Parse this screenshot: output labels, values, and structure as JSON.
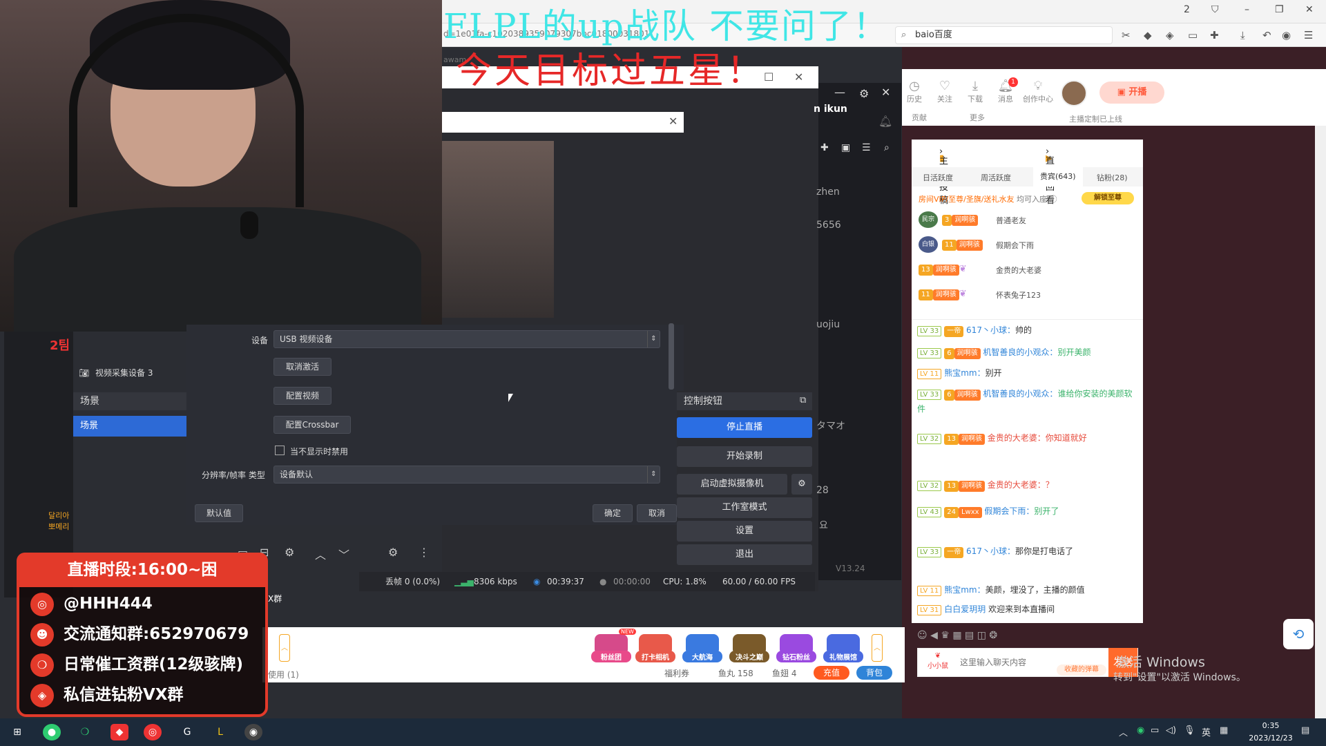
{
  "browser": {
    "search_text": "baio百度",
    "url_fragment": "d=1e01fa-c1020389359079307bbc01800031801",
    "tab_fragment": "awam",
    "tab_counter": "2"
  },
  "overlay": {
    "top_line": "FLPL的up战队 不要问了！",
    "second_line": "今天目标过五星！"
  },
  "header_icons": [
    {
      "label": "历史",
      "icon": "clock-icon"
    },
    {
      "label": "关注",
      "icon": "heart-icon"
    },
    {
      "label": "下载",
      "icon": "download-icon"
    },
    {
      "label": "消息",
      "icon": "bell-icon"
    },
    {
      "label": "创作中心",
      "icon": "bulb-icon"
    }
  ],
  "header": {
    "bell_count": "1",
    "open_label": "开播",
    "sub_left": "贡献",
    "sub_mid": "更多",
    "sub_right": "主播定制已上线"
  },
  "rank": {
    "link_post": "主播投稿",
    "link_replay": "直播回看",
    "tabs": [
      "日活跃度",
      "周活跃度",
      "贵宾(643)",
      "钻粉(28)"
    ],
    "vip_text": "房间VIP/至尊/圣旗/送礼水友",
    "vip_tail": "均可入座",
    "unlock": "解锁至尊",
    "rows": [
      {
        "level": "3",
        "badge": "润啊骇",
        "name": "普通老友",
        "icon": "民宗"
      },
      {
        "level": "11",
        "badge": "润啊骇",
        "name": "假期会下雨",
        "icon": "白银"
      },
      {
        "level": "13",
        "badge": "润啊骇",
        "name": "金贵的大老婆",
        "icon": ""
      },
      {
        "level": "11",
        "badge": "润啊骇",
        "name": "怀表兔子123",
        "icon": ""
      }
    ]
  },
  "chat": [
    {
      "lv": "LV 33",
      "fan": "一帝",
      "nick": "617丶小球：",
      "msg": "帅的",
      "msg_color": "normal"
    },
    {
      "lv": "LV 33",
      "fan": "润啊骇",
      "fan_lvl": "6",
      "nick": "机智善良的小观众：",
      "msg": "别开美颜",
      "msg_color": "green"
    },
    {
      "lv": "LV 11",
      "fan": "",
      "nick": "熊宝mm：",
      "msg": "别开",
      "msg_color": "normal"
    },
    {
      "lv": "LV 33",
      "fan": "润啊骇",
      "fan_lvl": "6",
      "nick": "机智善良的小观众：",
      "msg": "谁给你安装的美颜软件",
      "msg_color": "green"
    },
    {
      "lv": "LV 32",
      "fan": "润啊骇",
      "fan_lvl": "13",
      "nick": "金贵的大老婆：",
      "msg": "你知道就好",
      "msg_color": "red"
    },
    {
      "lv": "LV 32",
      "fan": "润啊骇",
      "fan_lvl": "13",
      "nick": "金贵的大老婆：",
      "msg": "？",
      "msg_color": "red"
    },
    {
      "lv": "LV 43",
      "fan": "Lwxx",
      "fan_lvl": "24",
      "nick": "假期会下雨：",
      "msg": "别开了",
      "msg_color": "green"
    },
    {
      "lv": "LV 33",
      "fan": "一帝",
      "nick": "617丶小球：",
      "msg": "那你是打电话了",
      "msg_color": "normal"
    },
    {
      "lv": "LV 11",
      "fan": "",
      "nick": "熊宝mm：",
      "msg": "美颜，埋没了，主播的颜值",
      "msg_color": "normal"
    },
    {
      "lv": "LV 31",
      "fan": "",
      "nick": "白白爱玥玥",
      "msg": "欢迎来到本直播间",
      "msg_color": "normal"
    }
  ],
  "chat_input": {
    "placeholder": "这里输入聊天内容",
    "send": "发送",
    "barrage": "收藏的弹幕",
    "mascot": "小小鼠"
  },
  "obs": {
    "source_name": "视频采集设备 3",
    "scenes_header": "场景",
    "scene_selected": "场景",
    "controls_header": "控制按钮",
    "controls": [
      "停止直播",
      "开始录制",
      "启动虚拟摄像机",
      "工作室模式",
      "设置",
      "退出"
    ],
    "right_labels": [
      "n ikun",
      "zhen",
      "5656",
      "uojiu",
      "タマオ",
      "28",
      "요",
      "V13.24"
    ]
  },
  "dialog": {
    "device_label": "设备",
    "device_value": "USB 视频设备",
    "btn_deactivate": "取消激活",
    "btn_config_video": "配置视频",
    "btn_crossbar": "配置Crossbar",
    "checkbox_label": "当不显示时禁用",
    "res_label": "分辨率/帧率 类型",
    "res_value": "设备默认",
    "btn_defaults": "默认值",
    "btn_ok": "确定",
    "btn_cancel": "取消"
  },
  "status": {
    "dropped": "丢帧 0 (0.0%)",
    "bitrate": "8306 kbps",
    "live_time": "00:39:37",
    "rec_time": "00:00:00",
    "cpu": "CPU: 1.8%",
    "fps": "60.00 / 60.00 FPS"
  },
  "info_card": {
    "head": "直播时段:16:00~困",
    "rows": [
      {
        "icon": "weibo-icon",
        "text": "@HHH444"
      },
      {
        "icon": "qq-icon",
        "text": "交流通知群:652970679"
      },
      {
        "icon": "wechat-icon",
        "text": "日常催工资群(12级骇牌)"
      },
      {
        "icon": "diamond-icon",
        "text": "私信进钻粉VX群"
      }
    ],
    "side_text": "2팀",
    "lower_text": "달리아\n뽀메리"
  },
  "gifts": [
    {
      "label": "粉丝团",
      "color": "#d64a8a",
      "new": "NEW",
      "top": "超级"
    },
    {
      "label": "打卡相机",
      "color": "#e8594a"
    },
    {
      "label": "大航海",
      "color": "#3a7ae0"
    },
    {
      "label": "决斗之巅",
      "color": "#7a5a2a"
    },
    {
      "label": "钻石粉丝",
      "color": "#9a4ae0"
    },
    {
      "label": "礼物展馆",
      "color": "#4a6ae0"
    }
  ],
  "gift_footer": {
    "welfare": "福利券",
    "fishball": "鱼丸 158",
    "fishfin": "鱼翅 4",
    "recharge": "充值",
    "backpack": "背包",
    "use_text": "使用 (1)",
    "group_text": "X群"
  },
  "watermark": {
    "line1": "激活 Windows",
    "line2": "转到\"设置\"以激活 Windows。"
  },
  "taskbar": {
    "time": "0:35",
    "date": "2023/12/23",
    "ime": "英"
  }
}
